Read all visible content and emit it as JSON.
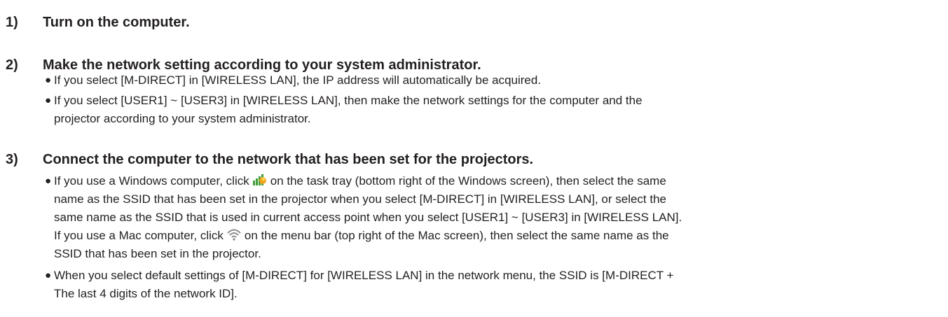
{
  "steps": [
    {
      "number": "1)",
      "title": "Turn on the computer."
    },
    {
      "number": "2)",
      "title": "Make the network setting according to your system administrator.",
      "bullets": [
        "If you select [M-DIRECT] in [WIRELESS LAN], the IP address will automatically be acquired.",
        [
          "If you select [USER1] ~ [USER3] in [WIRELESS LAN], then make the network settings for the computer and the",
          "projector according to your system administrator."
        ]
      ]
    },
    {
      "number": "3)",
      "title": "Connect the computer to the network that has been set for the projectors.",
      "bullet_a": {
        "l1_pre": "If you use a Windows computer, click",
        "l1_post": "on the task tray (bottom right of the Windows screen), then select the same",
        "l2": "name as the SSID that has been set in the projector when you select [M-DIRECT] in [WIRELESS LAN], or select the",
        "l3": "same name as the SSID that is used in current access point when you select [USER1] ~ [USER3] in [WIRELESS LAN].",
        "l4_pre": "If you use a Mac computer, click",
        "l4_post": "on the menu bar (top right of the Mac screen), then select the same name as the",
        "l5": "SSID that has been set in the projector."
      },
      "bullet_b": {
        "l1": "When you select default settings of [M-DIRECT] for [WIRELESS LAN] in the network menu, the SSID is [M-DIRECT +",
        "l2": "The last 4 digits of the network ID]."
      }
    }
  ],
  "icons": {
    "windows_tray": "windows-network-tray-icon",
    "mac_wifi": "mac-wifi-icon"
  },
  "bullet_symbol": "●"
}
